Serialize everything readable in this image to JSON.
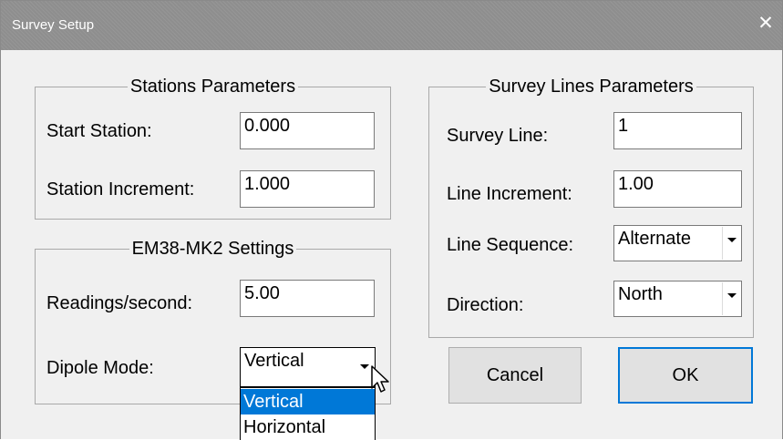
{
  "window": {
    "title": "Survey Setup",
    "close_glyph": "✕"
  },
  "stations": {
    "legend": "Stations Parameters",
    "start_station_label": "Start Station:",
    "start_station_value": "0.000",
    "station_increment_label": "Station Increment:",
    "station_increment_value": "1.000"
  },
  "em38": {
    "legend": "EM38-MK2 Settings",
    "readings_label": "Readings/second:",
    "readings_value": "5.00",
    "dipole_label": "Dipole Mode:",
    "dipole_value": "Vertical",
    "dipole_options": [
      "Vertical",
      "Horizontal"
    ],
    "dipole_selected_index": 0
  },
  "survey_lines": {
    "legend": "Survey Lines Parameters",
    "survey_line_label": "Survey Line:",
    "survey_line_value": "1",
    "line_increment_label": "Line Increment:",
    "line_increment_value": "1.00",
    "line_sequence_label": "Line Sequence:",
    "line_sequence_value": "Alternate",
    "direction_label": "Direction:",
    "direction_value": "North"
  },
  "buttons": {
    "cancel": "Cancel",
    "ok": "OK"
  },
  "icons": {
    "close": "close-icon",
    "combo_arrow": "chevron-down-icon",
    "cursor": "mouse-pointer-icon"
  },
  "colors": {
    "titlebar": "#8e8e8e",
    "selection": "#0078d7",
    "default_button_border": "#0078d7",
    "dialog_bg": "#f0f0f0"
  }
}
